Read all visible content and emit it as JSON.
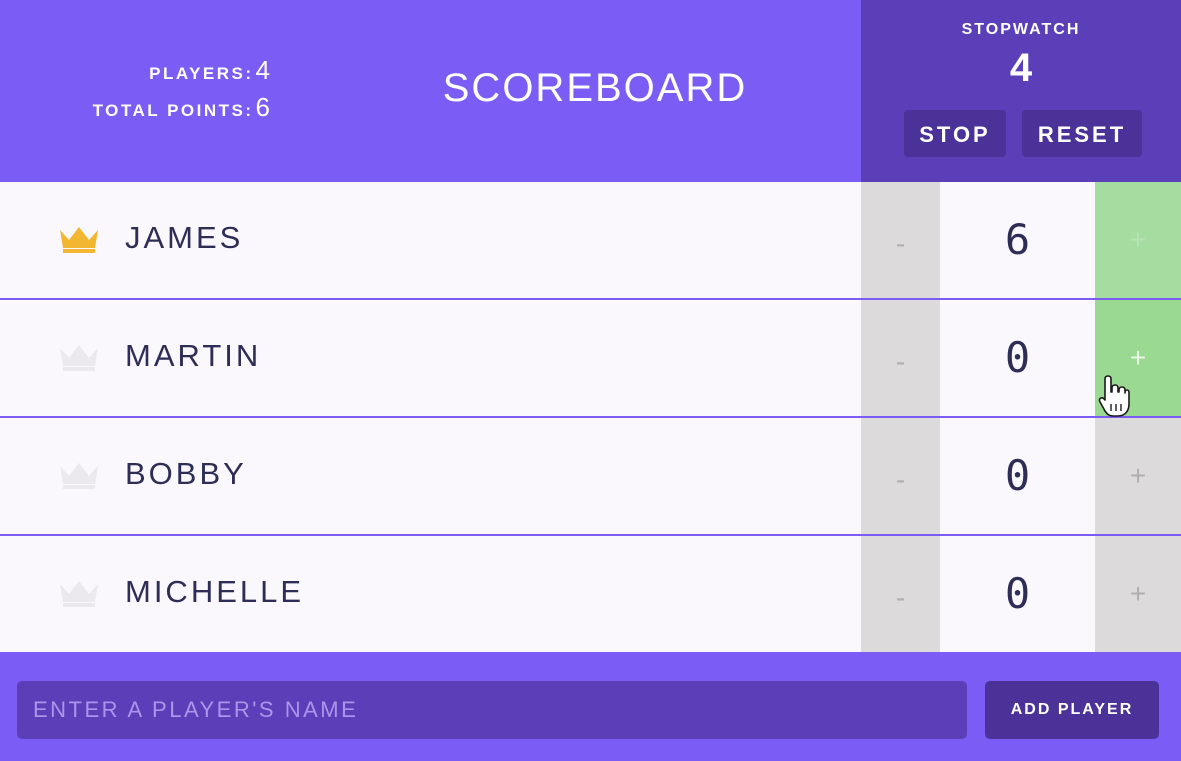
{
  "header": {
    "players_label": "PLAYERS:",
    "players_value": "4",
    "points_label": "TOTAL POINTS:",
    "points_value": "6",
    "title": "SCOREBOARD"
  },
  "stopwatch": {
    "label": "STOPWATCH",
    "time": "4",
    "stop_label": "STOP",
    "reset_label": "RESET"
  },
  "players": [
    {
      "name": "JAMES",
      "score": "6",
      "leader": true,
      "dec": "-",
      "inc": "+"
    },
    {
      "name": "MARTIN",
      "score": "0",
      "leader": false,
      "dec": "-",
      "inc": "+"
    },
    {
      "name": "BOBBY",
      "score": "0",
      "leader": false,
      "dec": "-",
      "inc": "+"
    },
    {
      "name": "MICHELLE",
      "score": "0",
      "leader": false,
      "dec": "-",
      "inc": "+"
    }
  ],
  "add_player": {
    "placeholder": "ENTER A PLAYER'S NAME",
    "button_label": "ADD PLAYER"
  },
  "colors": {
    "header_bg": "#7b5cf4",
    "stopwatch_bg": "#5b3fb9",
    "button_bg": "#4a3298",
    "crown_active": "#f2b630",
    "crown_inactive": "#ebe8ee",
    "plus_hover": "#9ad991"
  }
}
